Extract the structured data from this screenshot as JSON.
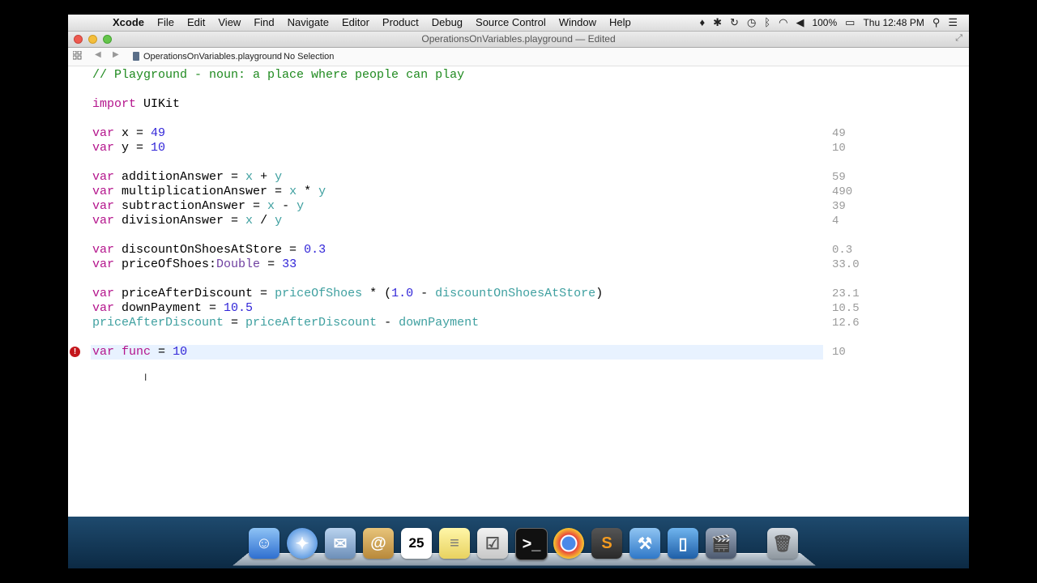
{
  "menubar": {
    "app": "Xcode",
    "items": [
      "File",
      "Edit",
      "View",
      "Find",
      "Navigate",
      "Editor",
      "Product",
      "Debug",
      "Source Control",
      "Window",
      "Help"
    ],
    "battery": "100%",
    "clock": "Thu 12:48 PM"
  },
  "window": {
    "title": "OperationsOnVariables.playground — Edited"
  },
  "jumpbar": {
    "file": "OperationsOnVariables.playground",
    "selection": "No Selection"
  },
  "results": [
    "49",
    "10",
    "59",
    "490",
    "39",
    "4",
    "0.3",
    "33.0",
    "23.1",
    "10.5",
    "12.6",
    "10"
  ],
  "dock": {
    "calendar_day": "25"
  }
}
